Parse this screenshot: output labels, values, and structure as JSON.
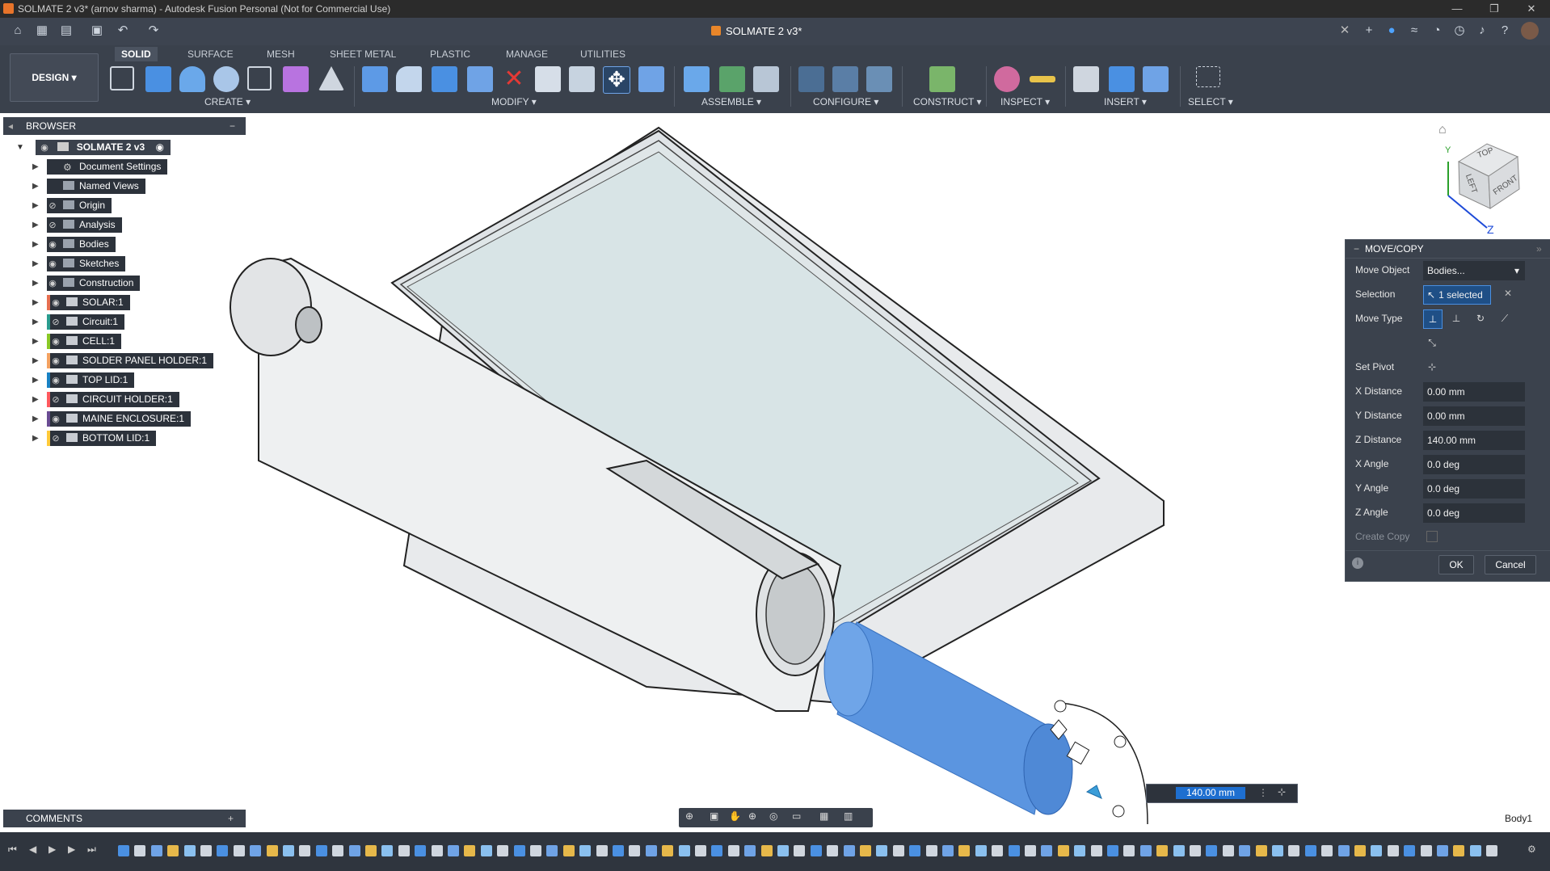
{
  "window": {
    "title": "SOLMATE 2 v3* (arnov sharma) - Autodesk Fusion Personal (Not for Commercial Use)",
    "controls": [
      "—",
      "❐",
      "✕"
    ]
  },
  "appbar": {
    "document_tab": "SOLMATE 2 v3*",
    "icons": [
      "home-icon",
      "grid-icon",
      "file-icon",
      "save-icon",
      "undo-icon",
      "redo-icon",
      "add-tab-icon",
      "help-icon",
      "notification-icon",
      "account-icon"
    ]
  },
  "toolbar": {
    "workspace": "DESIGN",
    "tabs": [
      "SOLID",
      "SURFACE",
      "MESH",
      "SHEET METAL",
      "PLASTIC",
      "MANAGE",
      "UTILITIES"
    ],
    "active_tab": "SOLID",
    "groups": [
      "CREATE",
      "MODIFY",
      "ASSEMBLE",
      "CONFIGURE",
      "CONSTRUCT",
      "INSPECT",
      "INSERT",
      "SELECT"
    ]
  },
  "browser": {
    "header": "BROWSER",
    "root": "SOLMATE 2 v3",
    "items": [
      {
        "label": "Document Settings",
        "icon": "gear-icon",
        "eye": false
      },
      {
        "label": "Named Views",
        "icon": "folder-icon",
        "eye": false
      },
      {
        "label": "Origin",
        "icon": "folder-icon",
        "eye": true,
        "hidden": true
      },
      {
        "label": "Analysis",
        "icon": "folder-icon",
        "eye": true,
        "hidden": true
      },
      {
        "label": "Bodies",
        "icon": "folder-icon",
        "eye": true
      },
      {
        "label": "Sketches",
        "icon": "folder-icon",
        "eye": true
      },
      {
        "label": "Construction",
        "icon": "folder-icon",
        "eye": true
      },
      {
        "label": "SOLAR:1",
        "icon": "component-icon",
        "eye": true,
        "tag": "#e76f51"
      },
      {
        "label": "Circuit:1",
        "icon": "component-icon",
        "eye": true,
        "hidden": true,
        "tag": "#2a9d8f"
      },
      {
        "label": "CELL:1",
        "icon": "component-icon",
        "eye": true,
        "tag": "#8ac926"
      },
      {
        "label": "SOLDER PANEL HOLDER:1",
        "icon": "component-icon",
        "eye": true,
        "tag": "#f4a261"
      },
      {
        "label": "TOP LID:1",
        "icon": "component-icon",
        "eye": true,
        "tag": "#1982c4"
      },
      {
        "label": "CIRCUIT HOLDER:1",
        "icon": "component-icon",
        "eye": true,
        "hidden": true,
        "tag": "#ff595e"
      },
      {
        "label": "MAINE ENCLOSURE:1",
        "icon": "component-icon",
        "eye": true,
        "tag": "#6a4c93"
      },
      {
        "label": "BOTTOM LID:1",
        "icon": "component-icon",
        "eye": true,
        "hidden": true,
        "tag": "#ffca3a"
      }
    ]
  },
  "viewcube": {
    "top": "TOP",
    "left": "LEFT",
    "front": "FRONT",
    "axis_z": "Z",
    "axis_y": "Y"
  },
  "move_copy": {
    "title": "MOVE/COPY",
    "labels": {
      "move_object": "Move Object",
      "selection": "Selection",
      "move_type": "Move Type",
      "set_pivot": "Set Pivot",
      "x_distance": "X Distance",
      "y_distance": "Y Distance",
      "z_distance": "Z Distance",
      "x_angle": "X Angle",
      "y_angle": "Y Angle",
      "z_angle": "Z Angle",
      "create_copy": "Create Copy"
    },
    "values": {
      "move_object": "Bodies...",
      "selection": "1 selected",
      "x_distance": "0.00 mm",
      "y_distance": "0.00 mm",
      "z_distance": "140.00 mm",
      "x_angle": "0.0 deg",
      "y_angle": "0.0 deg",
      "z_angle": "0.0 deg"
    },
    "ok": "OK",
    "cancel": "Cancel"
  },
  "dimension_input": "140.00 mm",
  "comments": {
    "header": "COMMENTS"
  },
  "status": {
    "selected_body": "Body1"
  },
  "colors": {
    "accent": "#1e6fd0",
    "selected_body": "#5b95e0",
    "model_gray": "#e6e8ea",
    "panel": "#3b424d"
  }
}
